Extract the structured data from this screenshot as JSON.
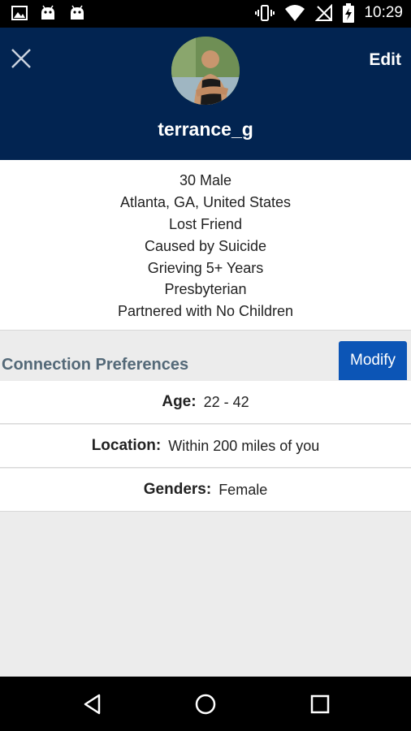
{
  "status_bar": {
    "time": "10:29",
    "left_icons": [
      "image-icon",
      "android-icon",
      "android-icon"
    ],
    "right_icons": [
      "vibrate-icon",
      "wifi-icon",
      "no-signal-icon",
      "battery-charging-icon"
    ]
  },
  "header": {
    "username": "terrance_g",
    "edit_label": "Edit",
    "close_icon": "close-icon",
    "background_color": "#022451"
  },
  "profile": {
    "lines": [
      "30 Male",
      "Atlanta, GA, United States",
      "Lost Friend",
      "Caused by Suicide",
      "Grieving 5+ Years",
      "Presbyterian",
      "Partnered with No Children"
    ]
  },
  "connection_preferences": {
    "title": "Connection Preferences",
    "modify_label": "Modify",
    "modify_color": "#0c55b6",
    "rows": [
      {
        "label": "Age:",
        "value": "22 - 42"
      },
      {
        "label": "Location:",
        "value": "Within 200 miles of you"
      },
      {
        "label": "Genders:",
        "value": "Female"
      }
    ]
  },
  "nav_bar": {
    "icons": [
      "back-icon",
      "home-icon",
      "recents-icon"
    ]
  }
}
